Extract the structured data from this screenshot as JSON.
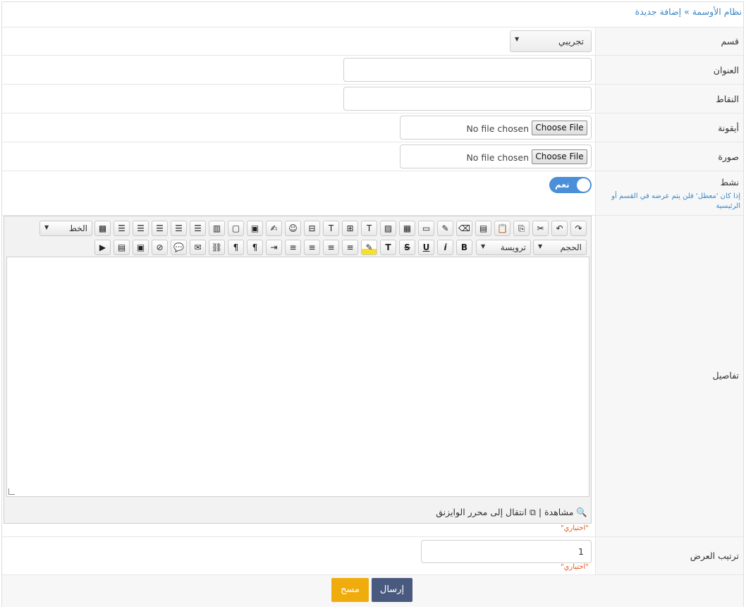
{
  "breadcrumb": {
    "root": "نظام الأوسمة",
    "separator": "»",
    "current": "إضافة جديدة"
  },
  "form": {
    "section": {
      "label": "قسم",
      "value": "تجريبي"
    },
    "title": {
      "label": "العنوان",
      "value": ""
    },
    "points": {
      "label": "النقاط",
      "value": ""
    },
    "icon": {
      "label": "أيقونة",
      "button": "Choose File",
      "status": "No file chosen"
    },
    "image": {
      "label": "صورة",
      "button": "Choose File",
      "status": "No file chosen"
    },
    "active": {
      "label": "نشط",
      "toggle_text": "نعم",
      "hint": "إذا كان 'معطل' فلن يتم عرضه في القسم أو الرئيسية"
    },
    "details": {
      "label": "تفاصيل",
      "font_select": "الخط",
      "size_select": "الحجم",
      "heading_select": "ترويسة",
      "preview": "مشاهدة",
      "divider": "|",
      "switch_editor": "انتقال إلى محرر الوايزنق",
      "optional": "\"اختياري\""
    },
    "order": {
      "label": "ترتيب العرض",
      "value": "1",
      "optional": "\"اختياري\""
    }
  },
  "buttons": {
    "submit": "إرسال",
    "clear": "مسح"
  },
  "colors": {
    "link": "#3a87c7",
    "toggle": "#4a8fd8",
    "submit": "#4a5a7e",
    "clear": "#f0ac0c",
    "optional": "#e05a20"
  }
}
